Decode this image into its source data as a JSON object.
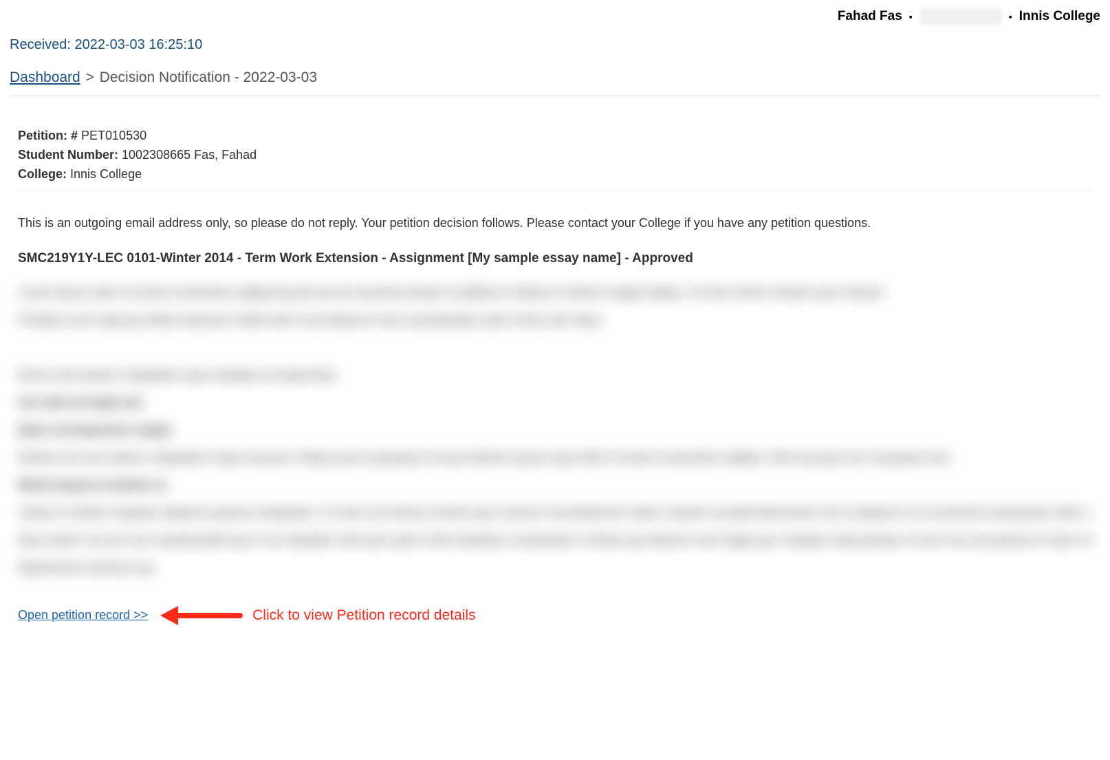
{
  "header": {
    "user_name": "Fahad Fas",
    "college": "Innis College"
  },
  "received": {
    "label": "Received:",
    "timestamp": "2022-03-03 16:25:10"
  },
  "breadcrumb": {
    "dashboard_label": "Dashboard",
    "separator": ">",
    "current": "Decision Notification - 2022-03-03"
  },
  "info": {
    "petition_label": "Petition: #",
    "petition_value": "PET010530",
    "student_number_label": "Student Number:",
    "student_number_value": "1002308665 Fas, Fahad",
    "college_label": "College:",
    "college_value": "Innis College"
  },
  "body_note": "This is an outgoing email address only, so please do not reply. Your petition decision follows. Please contact your College if you have any petition questions.",
  "decision_title": "SMC219Y1Y-LEC 0101-Winter 2014 - Term Work Extension - Assignment [My sample essay name] - Approved",
  "footer": {
    "open_link_label": "Open petition record >>",
    "annotation": "Click to view Petition record details"
  }
}
